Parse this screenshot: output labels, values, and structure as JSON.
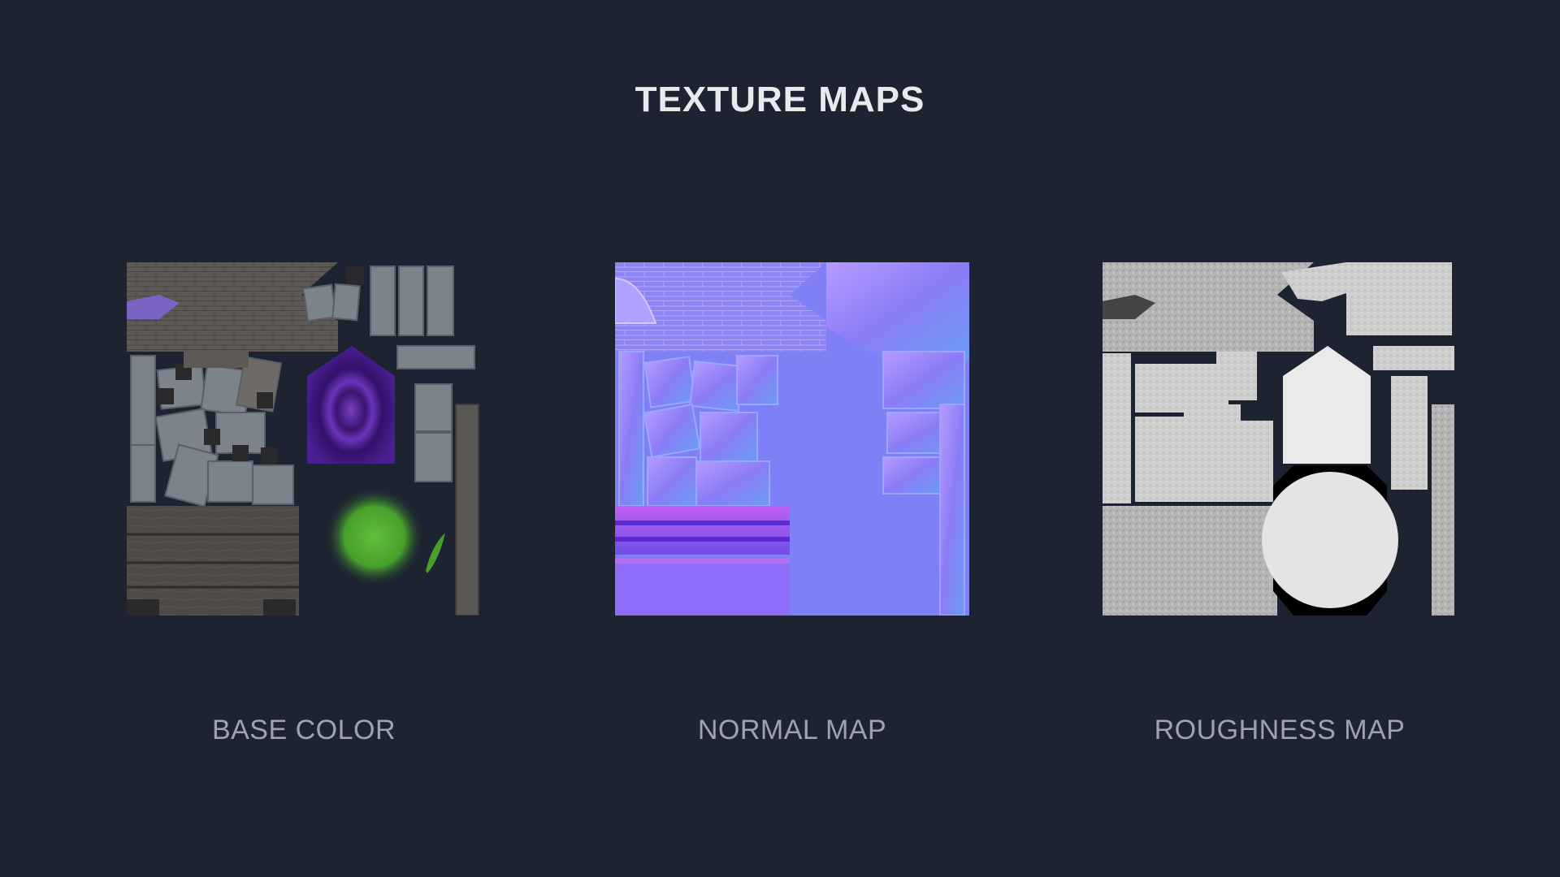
{
  "page": {
    "title": "TEXTURE MAPS",
    "background_color": "#1d2331"
  },
  "maps": [
    {
      "label": "BASE COLOR",
      "kind": "base-color"
    },
    {
      "label": "NORMAL MAP",
      "kind": "normal-map"
    },
    {
      "label": "ROUGHNESS MAP",
      "kind": "roughness-map"
    }
  ]
}
